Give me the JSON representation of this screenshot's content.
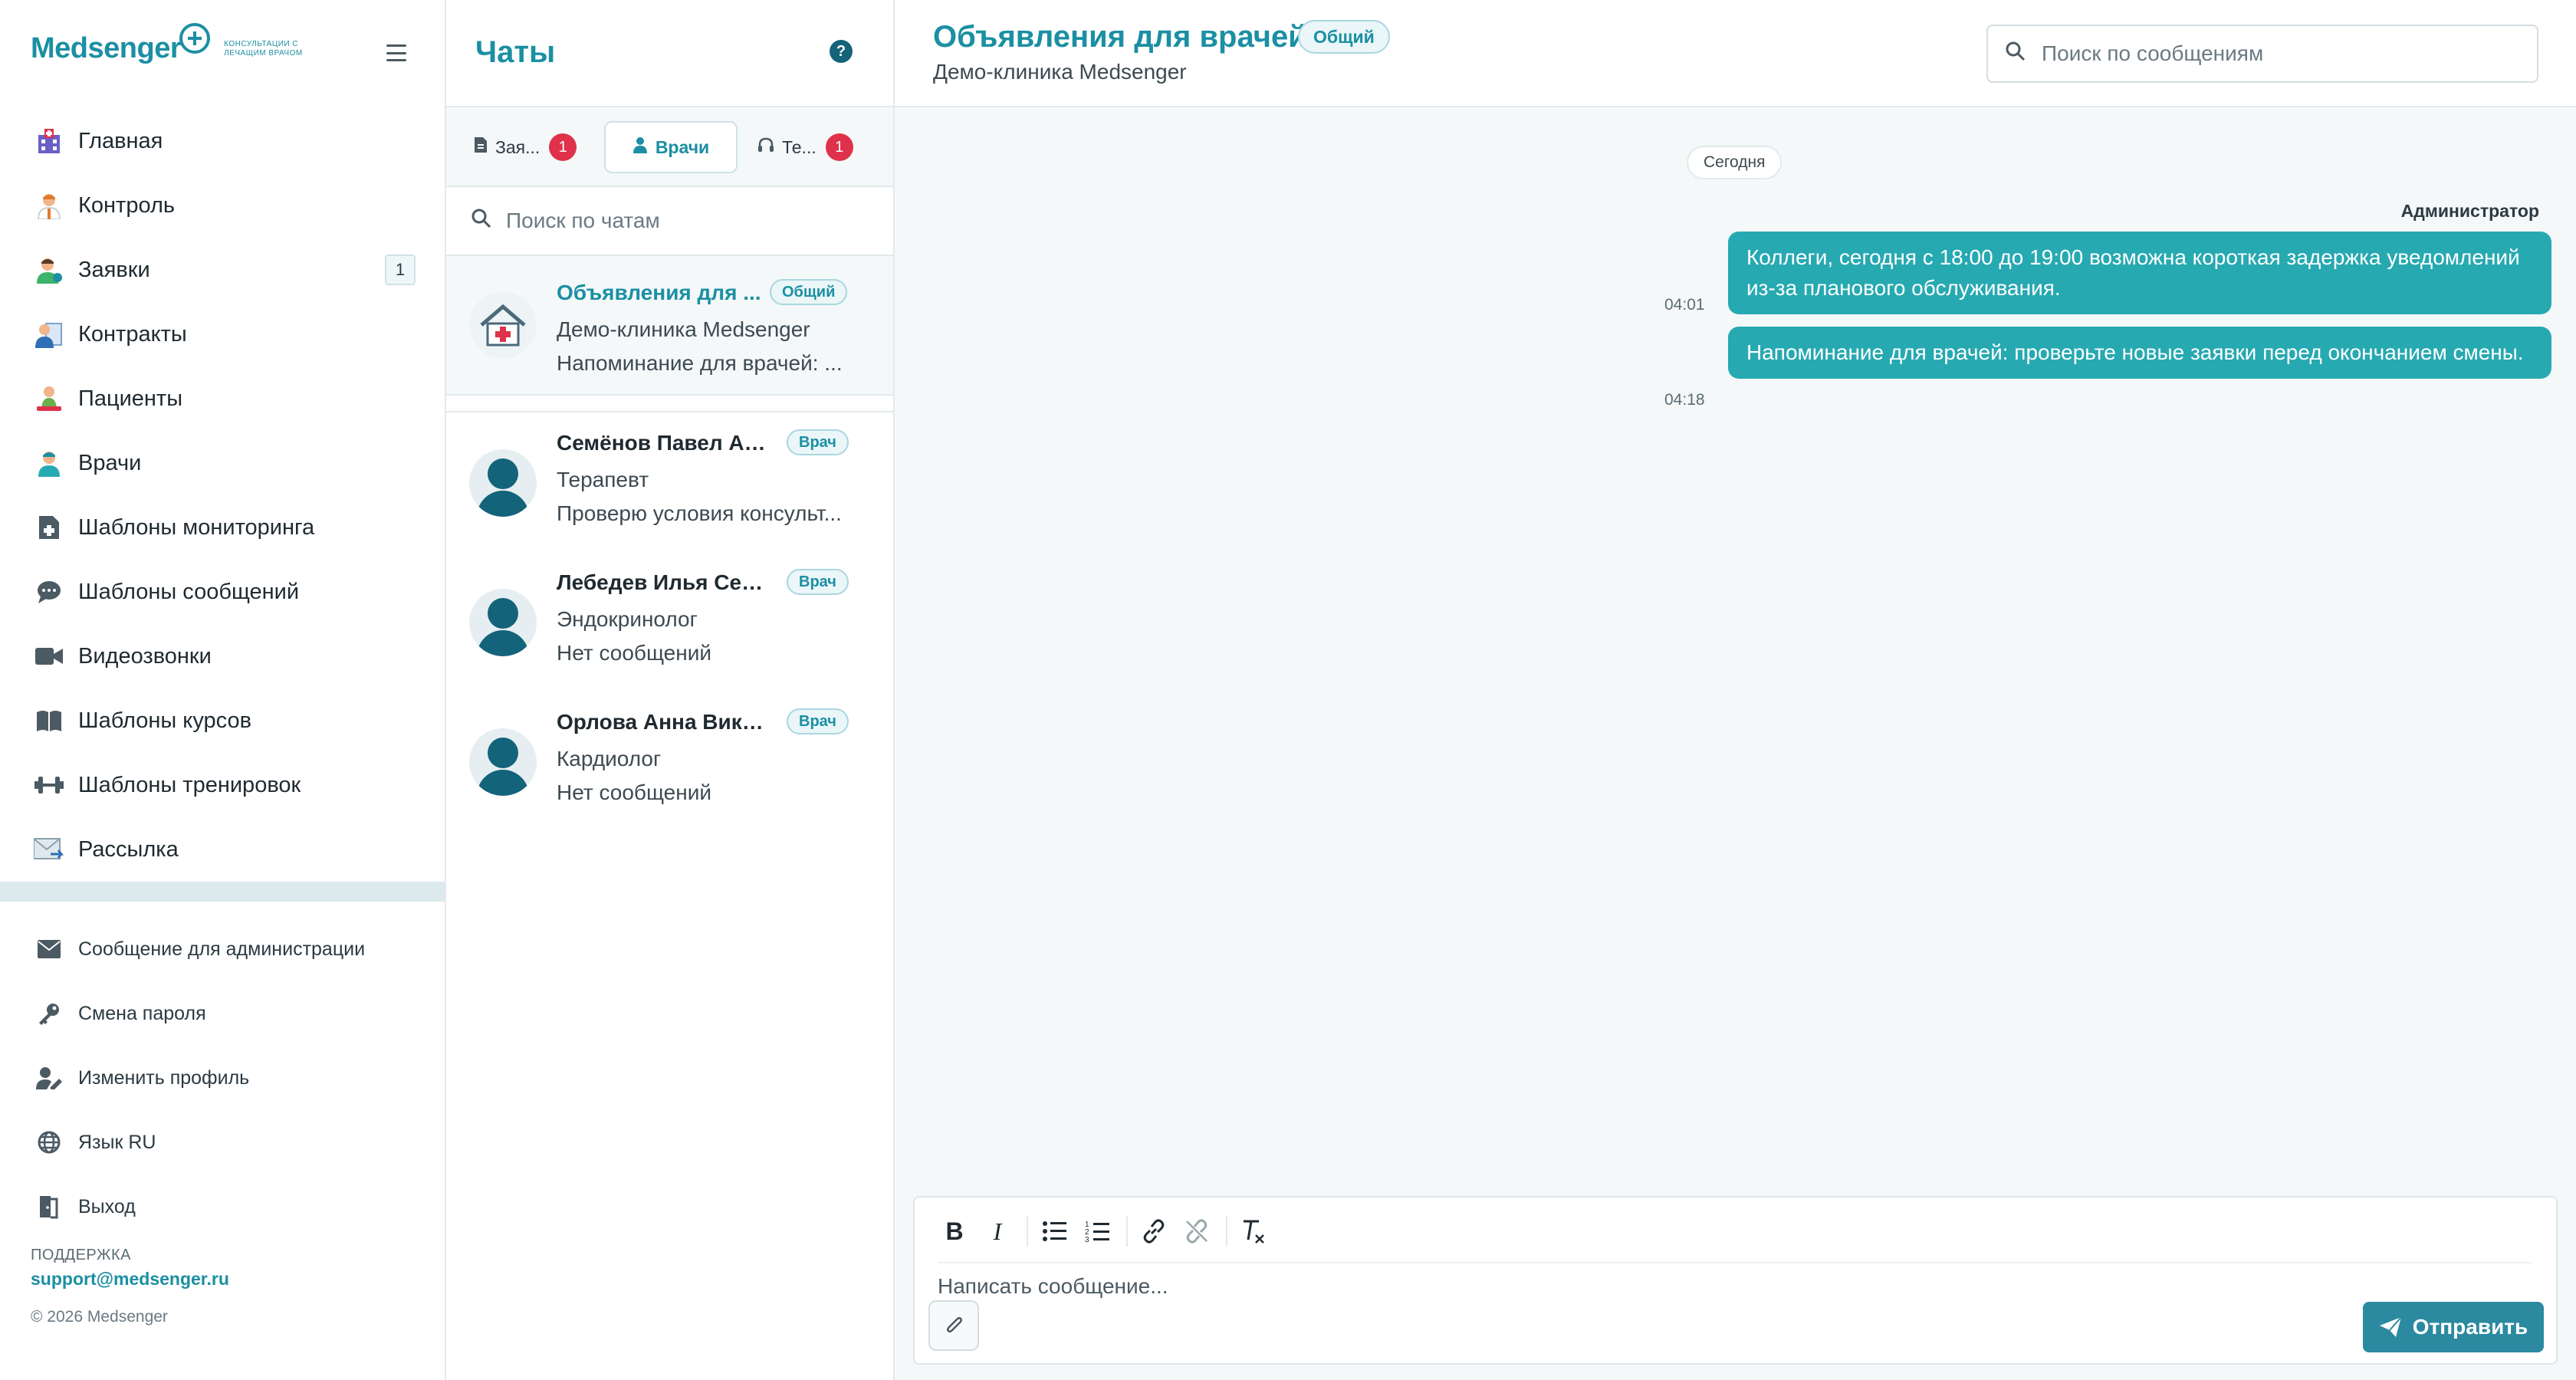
{
  "brand": {
    "name": "Medsenger",
    "tagline": "КОНСУЛЬТАЦИИ С ЛЕЧАЩИМ ВРАЧОМ",
    "accent": "#1b8fa3"
  },
  "sidebar": {
    "items": [
      {
        "label": "Главная",
        "icon": "hospital-icon"
      },
      {
        "label": "Контроль",
        "icon": "doctor-icon"
      },
      {
        "label": "Заявки",
        "icon": "user-request-icon",
        "badge": "1"
      },
      {
        "label": "Контракты",
        "icon": "contract-icon"
      },
      {
        "label": "Пациенты",
        "icon": "patient-icon"
      },
      {
        "label": "Врачи",
        "icon": "doctor-green-icon"
      },
      {
        "label": "Шаблоны мониторинга",
        "icon": "file-medical-icon"
      },
      {
        "label": "Шаблоны сообщений",
        "icon": "comment-icon"
      },
      {
        "label": "Видеозвонки",
        "icon": "video-icon"
      },
      {
        "label": "Шаблоны курсов",
        "icon": "book-icon"
      },
      {
        "label": "Шаблоны тренировок",
        "icon": "dumbbell-icon"
      },
      {
        "label": "Рассылка",
        "icon": "mail-send-icon"
      }
    ],
    "bottom_items": [
      {
        "label": "Сообщение для администрации",
        "icon": "envelope-icon"
      },
      {
        "label": "Смена пароля",
        "icon": "key-icon"
      },
      {
        "label": "Изменить профиль",
        "icon": "user-edit-icon"
      },
      {
        "label": "Язык RU",
        "icon": "globe-icon"
      },
      {
        "label": "Выход",
        "icon": "door-icon"
      }
    ],
    "support_title": "ПОДДЕРЖКА",
    "support_email": "support@medsenger.ru",
    "copyright": "© 2026 Medsenger"
  },
  "chats": {
    "title": "Чаты",
    "tabs": [
      {
        "label": "Зая...",
        "badge": "1",
        "icon": "file-icon"
      },
      {
        "label": "Врачи",
        "icon": "doctor-icon",
        "active": true
      },
      {
        "label": "Те...",
        "badge": "1",
        "icon": "headset-icon"
      }
    ],
    "search_placeholder": "Поиск по чатам",
    "pinned": {
      "name": "Объявления для ...",
      "tag": "Общий",
      "line1": "Демо-клиника Medsenger",
      "line2": "Напоминание для врачей: ..."
    },
    "items": [
      {
        "name": "Семёнов Павел Ан...",
        "tag": "Врач",
        "line1": "Терапевт",
        "line2": "Проверю условия консульт..."
      },
      {
        "name": "Лебедев Илья Серг...",
        "tag": "Врач",
        "line1": "Эндокринолог",
        "line2": "Нет сообщений"
      },
      {
        "name": "Орлова Анна Викто...",
        "tag": "Врач",
        "line1": "Кардиолог",
        "line2": "Нет сообщений"
      }
    ]
  },
  "main": {
    "title": "Объявления для врачей",
    "tag": "Общий",
    "subtitle": "Демо-клиника Medsenger",
    "search_placeholder": "Поиск по сообщениям",
    "date_label": "Сегодня",
    "sender": "Администратор",
    "messages": [
      {
        "time": "04:01",
        "text": "Коллеги, сегодня с 18:00 до 19:00 возможна короткая задержка уведомлений из-за планового обслуживания."
      },
      {
        "time": "04:18",
        "text": "Напоминание для врачей: проверьте новые заявки перед окончанием смены."
      }
    ],
    "composer_placeholder": "Написать сообщение...",
    "send_label": "Отправить",
    "message_color": "#27a9b1"
  }
}
